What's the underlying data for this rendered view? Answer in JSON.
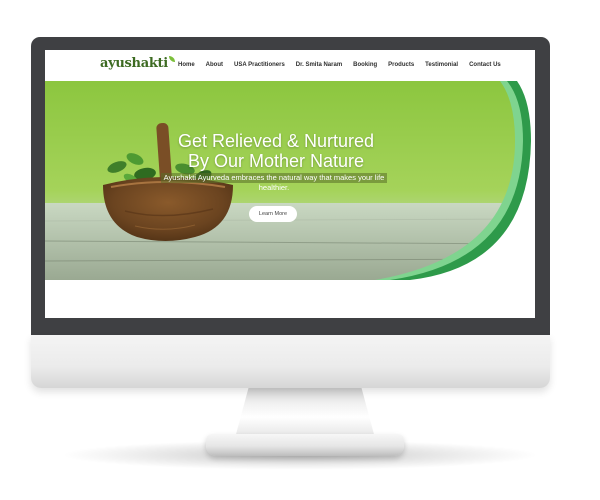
{
  "site": {
    "logo_text": "ayushakti"
  },
  "nav": {
    "items": [
      {
        "label": "Home"
      },
      {
        "label": "About"
      },
      {
        "label": "USA Practitioners"
      },
      {
        "label": "Dr. Smita Naram"
      },
      {
        "label": "Booking"
      },
      {
        "label": "Products"
      },
      {
        "label": "Testimonial"
      },
      {
        "label": "Contact Us"
      }
    ]
  },
  "hero": {
    "title_line1": "Get Relieved & Nurtured",
    "title_line2": "By Our Mother Nature",
    "subtitle_line1": "Ayushakti Ayurveda embraces the natural way that makes your life",
    "subtitle_line2": "healthier.",
    "cta_label": "Learn More"
  },
  "colors": {
    "brand_green": "#3d6b22",
    "hero_grass": "#9fd04a",
    "curve_dark": "#2e9a4a",
    "curve_light": "#7fd48f",
    "bezel": "#3f4043"
  }
}
